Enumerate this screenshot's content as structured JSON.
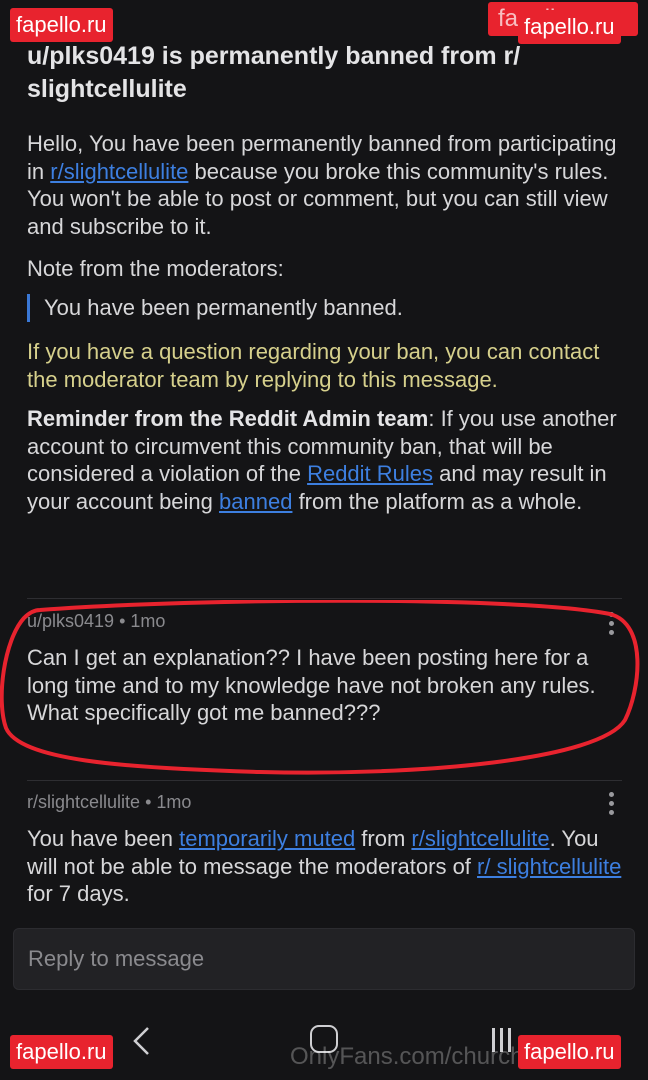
{
  "watermarks": {
    "top_left": "fapello.ru",
    "top_right": "fapello.ru",
    "top_right_ghost": "fapello.com",
    "bottom_left": "fapello.ru",
    "bottom_right": "fapello.ru",
    "onlyfans": "OnlyFans.com/churchofmy_u"
  },
  "message": {
    "title": "u/plks0419 is permanently banned from r/ slightcellulite",
    "intro_pre": "Hello, You have been permanently banned from participating in ",
    "intro_link": "r/slightcellulite",
    "intro_post": " because you broke this community's rules. You won't be able to post or comment, but you can still view and subscribe to it.",
    "note_label": "Note from the moderators:",
    "note_quote": "You have been permanently banned.",
    "contact": "If you have a question regarding your ban, you can contact the moderator team by replying to this message.",
    "reminder_bold": "Reminder from the Reddit Admin team",
    "reminder_pre": ": If you use another account to circumvent this community ban, that will be considered a violation of the ",
    "reminder_link1": "Reddit Rules",
    "reminder_mid": " and may result in your account being ",
    "reminder_link2": "banned",
    "reminder_post": " from the platform as a whole."
  },
  "reply1": {
    "author": "u/plks0419",
    "time": "1mo",
    "separator": "•",
    "text": "Can I get an explanation?? I have been posting here for a long time and to my knowledge have not broken any rules. What specifically got me banned???"
  },
  "reply2": {
    "author": "r/slightcellulite",
    "time": "1mo",
    "separator": "•",
    "text_pre": "You have been ",
    "link1": "temporarily muted",
    "text_mid": " from ",
    "link2": "r/slightcellulite",
    "text_mid2": ". You will not be able to message the moderators of ",
    "link3": "r/ slightcellulite",
    "text_post": " for 7 days."
  },
  "reply_box": {
    "placeholder": "Reply to message"
  },
  "nav": {
    "back_icon": "chevron-left-icon",
    "home_icon": "home-icon",
    "recents_icon": "recents-icon"
  },
  "colors": {
    "link": "#3d7fe0",
    "annotation_circle": "#e8232e",
    "contact_text": "#d6d08c"
  }
}
